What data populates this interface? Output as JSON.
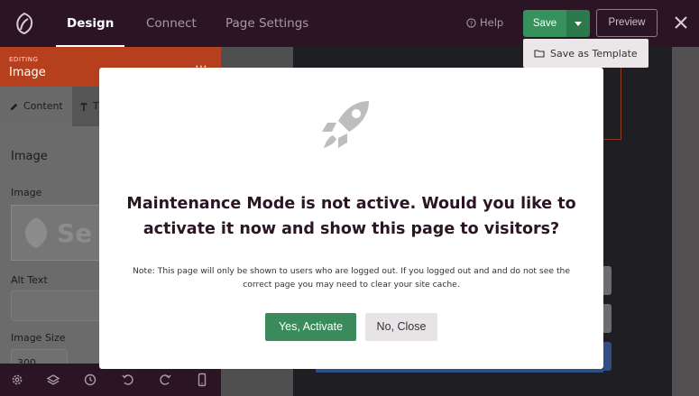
{
  "topbar": {
    "tabs": [
      {
        "label": "Design",
        "active": true
      },
      {
        "label": "Connect",
        "active": false
      },
      {
        "label": "Page Settings",
        "active": false
      }
    ],
    "help_label": "Help",
    "save_label": "Save",
    "preview_label": "Preview",
    "dropdown": {
      "save_as_template_label": "Save as Template"
    }
  },
  "panel": {
    "editing_label": "EDITING",
    "editing_title": "Image",
    "tabs": [
      {
        "label": "Content",
        "icon": "pencil-icon"
      },
      {
        "label": "T",
        "icon": "paragraph-icon"
      }
    ],
    "section_title": "Image",
    "image_label": "Image",
    "image_placeholder_text": "Se",
    "alt_text_label": "Alt Text",
    "image_size_label": "Image Size",
    "image_size_value": "300"
  },
  "modal": {
    "icon": "rocket-icon",
    "heading": "Maintenance Mode is not active. Would you like to activate it now and show this page to visitors?",
    "note": "Note: This page will only be shown to users who are logged out. If you logged out and and do not see the correct page you may need to clear your site cache.",
    "yes_label": "Yes, Activate",
    "no_label": "No, Close"
  },
  "colors": {
    "topbar": "#2b1524",
    "accent_orange": "#b6401e",
    "save_green": "#37915c",
    "yes_green": "#3a8a5c"
  }
}
